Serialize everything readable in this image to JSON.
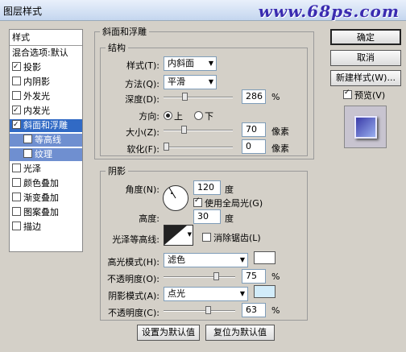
{
  "window": {
    "title": "图层样式",
    "watermark": "www.68ps.com"
  },
  "styles_panel": {
    "header": "样式",
    "items": [
      {
        "label": "混合选项:默认",
        "checkbox": false,
        "checked": false,
        "indent": false
      },
      {
        "label": "投影",
        "checkbox": true,
        "checked": true,
        "indent": false
      },
      {
        "label": "内阴影",
        "checkbox": true,
        "checked": false,
        "indent": false
      },
      {
        "label": "外发光",
        "checkbox": true,
        "checked": false,
        "indent": false
      },
      {
        "label": "内发光",
        "checkbox": true,
        "checked": true,
        "indent": false
      },
      {
        "label": "斜面和浮雕",
        "checkbox": true,
        "checked": true,
        "indent": false,
        "selected": true
      },
      {
        "label": "等高线",
        "checkbox": true,
        "checked": false,
        "indent": true
      },
      {
        "label": "纹理",
        "checkbox": true,
        "checked": false,
        "indent": true
      },
      {
        "label": "光泽",
        "checkbox": true,
        "checked": false,
        "indent": false
      },
      {
        "label": "颜色叠加",
        "checkbox": true,
        "checked": false,
        "indent": false
      },
      {
        "label": "渐变叠加",
        "checkbox": true,
        "checked": false,
        "indent": false
      },
      {
        "label": "图案叠加",
        "checkbox": true,
        "checked": false,
        "indent": false
      },
      {
        "label": "描边",
        "checkbox": true,
        "checked": false,
        "indent": false
      }
    ]
  },
  "bevel": {
    "section_title": "斜面和浮雕",
    "structure_title": "结构",
    "style_label": "样式(T):",
    "style_value": "内斜面",
    "technique_label": "方法(Q):",
    "technique_value": "平滑",
    "depth_label": "深度(D):",
    "depth_value": "286",
    "depth_unit": "%",
    "depth_level": 0.29,
    "direction_label": "方向:",
    "dir_up": "上",
    "dir_down": "下",
    "direction_selected": "上",
    "size_label": "大小(Z):",
    "size_value": "70",
    "size_unit": "像素",
    "size_level": 0.28,
    "soften_label": "软化(F):",
    "soften_value": "0",
    "soften_unit": "像素",
    "soften_level": 0
  },
  "shading": {
    "title": "阴影",
    "angle_label": "角度(N):",
    "angle_value": "120",
    "angle_unit": "度",
    "global_light_label": "使用全局光(G)",
    "global_light_checked": true,
    "altitude_label": "高度:",
    "altitude_value": "30",
    "altitude_unit": "度",
    "gloss_contour_label": "光泽等高线:",
    "antialias_label": "消除锯齿(L)",
    "antialias_checked": false,
    "highlight_mode_label": "高光模式(H):",
    "highlight_mode_value": "滤色",
    "highlight_color": "#ffffff",
    "highlight_opacity_label": "不透明度(O):",
    "highlight_opacity_value": "75",
    "highlight_opacity_unit": "%",
    "highlight_opacity_level": 0.75,
    "shadow_mode_label": "阴影模式(A):",
    "shadow_mode_value": "点光",
    "shadow_color": "#d2ecfa",
    "shadow_opacity_label": "不透明度(C):",
    "shadow_opacity_value": "63",
    "shadow_opacity_unit": "%",
    "shadow_opacity_level": 0.63
  },
  "bottom": {
    "set_default": "设置为默认值",
    "reset_default": "复位为默认值"
  },
  "right": {
    "ok": "确定",
    "cancel": "取消",
    "new_style": "新建样式(W)...",
    "preview_label": "预览(V)",
    "preview_checked": true
  }
}
